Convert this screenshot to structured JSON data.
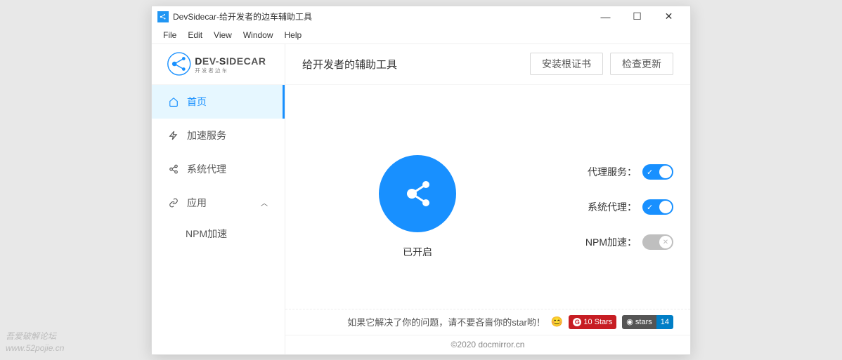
{
  "window": {
    "title": "DevSidecar-给开发者的边车辅助工具"
  },
  "menubar": {
    "items": [
      "File",
      "Edit",
      "View",
      "Window",
      "Help"
    ]
  },
  "logo": {
    "brand_top": "DEV-SIDECAR",
    "brand_sub": "开发者边车"
  },
  "sidebar": {
    "items": [
      {
        "label": "首页",
        "icon": "home-icon",
        "active": true
      },
      {
        "label": "加速服务",
        "icon": "bolt-icon",
        "active": false
      },
      {
        "label": "系统代理",
        "icon": "share-icon",
        "active": false
      },
      {
        "label": "应用",
        "icon": "link-icon",
        "active": false,
        "expandable": true
      }
    ],
    "sub_items": [
      {
        "label": "NPM加速"
      }
    ]
  },
  "header": {
    "title": "给开发者的辅助工具",
    "install_cert_btn": "安装根证书",
    "check_update_btn": "检查更新"
  },
  "status": {
    "label": "已开启"
  },
  "toggles": [
    {
      "label": "代理服务",
      "on": true,
      "disabled": false
    },
    {
      "label": "系统代理",
      "on": true,
      "disabled": false
    },
    {
      "label": "NPM加速",
      "on": false,
      "disabled": true
    }
  ],
  "star_row": {
    "text": "如果它解决了你的问题，请不要吝啬你的star哟！",
    "gitee": {
      "icon_label": "G",
      "label": "10 Stars"
    },
    "github": {
      "label": "stars",
      "count": "14"
    }
  },
  "footer": {
    "copyright": "©2020 docmirror.cn"
  },
  "watermark": {
    "line1": "吾爱破解论坛",
    "line2": "www.52pojie.cn"
  }
}
